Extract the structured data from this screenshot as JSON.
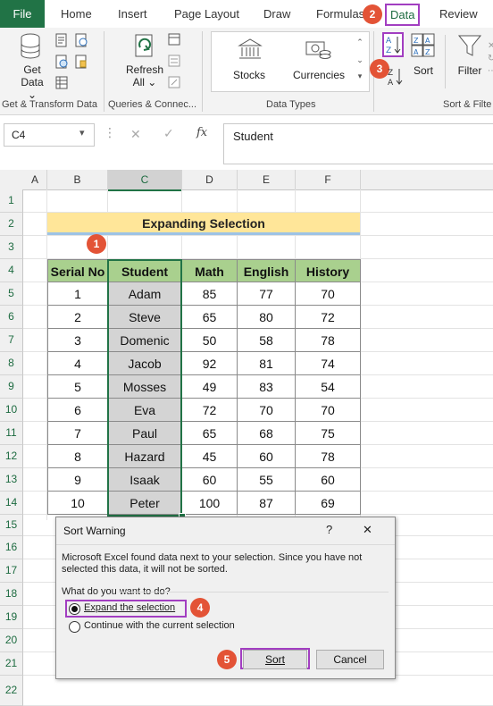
{
  "ribbon": {
    "tabs": [
      "File",
      "Home",
      "Insert",
      "Page Layout",
      "Draw",
      "Formulas",
      "Data",
      "Review"
    ],
    "groups": {
      "get_transform": {
        "get_data": "Get",
        "get_data2": "Data",
        "label": "Get & Transform Data"
      },
      "queries": {
        "refresh": "Refresh",
        "refresh2": "All",
        "label": "Queries & Connec..."
      },
      "data_types": {
        "stocks": "Stocks",
        "currencies": "Currencies",
        "label": "Data Types"
      },
      "sort_filter": {
        "sort": "Sort",
        "filter": "Filter",
        "label": "Sort & Filte"
      }
    }
  },
  "formula_bar": {
    "name_box": "C4",
    "fx": "fx",
    "content": "Student"
  },
  "columns": [
    "A",
    "B",
    "C",
    "D",
    "E",
    "F"
  ],
  "rows": [
    "1",
    "2",
    "3",
    "4",
    "5",
    "6",
    "7",
    "8",
    "9",
    "10",
    "11",
    "12",
    "13",
    "14",
    "15",
    "16",
    "17",
    "18",
    "19",
    "20",
    "21",
    "22"
  ],
  "sheet": {
    "title": "Expanding Selection",
    "headers": [
      "Serial No",
      "Student",
      "Math",
      "English",
      "History"
    ],
    "records": [
      [
        "1",
        "Adam",
        "85",
        "77",
        "70"
      ],
      [
        "2",
        "Steve",
        "65",
        "80",
        "72"
      ],
      [
        "3",
        "Domenic",
        "50",
        "58",
        "78"
      ],
      [
        "4",
        "Jacob",
        "92",
        "81",
        "74"
      ],
      [
        "5",
        "Mosses",
        "49",
        "83",
        "54"
      ],
      [
        "6",
        "Eva",
        "72",
        "70",
        "70"
      ],
      [
        "7",
        "Paul",
        "65",
        "68",
        "75"
      ],
      [
        "8",
        "Hazard",
        "45",
        "60",
        "78"
      ],
      [
        "9",
        "Isaak",
        "60",
        "55",
        "60"
      ],
      [
        "10",
        "Peter",
        "100",
        "87",
        "69"
      ]
    ]
  },
  "dialog": {
    "title": "Sort Warning",
    "help": "?",
    "close": "✕",
    "message": "Microsoft Excel found data next to your selection.  Since you have not selected this data, it will not be sorted.",
    "question": "What do you want to do?",
    "option_expand": "Expand the selection",
    "option_continue": "Continue with the current selection",
    "sort_button": "Sort",
    "cancel_button": "Cancel"
  },
  "badges": [
    "1",
    "2",
    "3",
    "4",
    "5"
  ],
  "colors": {
    "excel_green": "#217346",
    "header_fill": "#a9d08e",
    "title_fill": "#ffe699",
    "highlight": "#a23ec1",
    "badge": "#e35336"
  }
}
